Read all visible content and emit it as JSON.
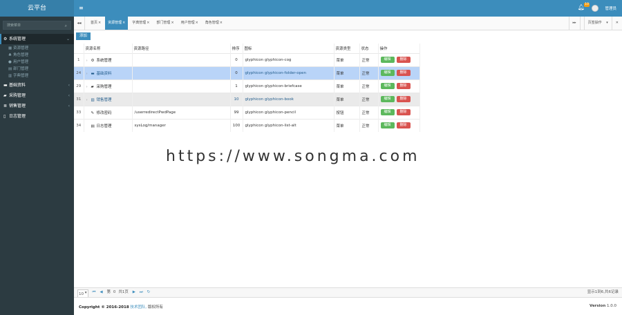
{
  "brand": "云平台",
  "search": {
    "placeholder": "搜索菜单"
  },
  "sidebar": {
    "groups": [
      {
        "label": "系统管理",
        "icon": "gear-icon",
        "arrow": "⌄"
      },
      {
        "label": "基础资料",
        "icon": "folder-icon",
        "arrow": "‹"
      },
      {
        "label": "采购管理",
        "icon": "cart-icon",
        "arrow": "‹"
      },
      {
        "label": "销售管理",
        "icon": "list-icon",
        "arrow": "‹"
      },
      {
        "label": "日志管理",
        "icon": "book-icon",
        "arrow": ""
      }
    ],
    "subitems": [
      {
        "label": "资源管理",
        "icon": "grid-icon"
      },
      {
        "label": "角色管理",
        "icon": "users-icon"
      },
      {
        "label": "用户管理",
        "icon": "user-icon"
      },
      {
        "label": "部门管理",
        "icon": "sitemap-icon"
      },
      {
        "label": "字典管理",
        "icon": "book-icon"
      }
    ]
  },
  "topbar": {
    "notif_count": "10",
    "username": "管理员"
  },
  "tabs": {
    "items": [
      {
        "label": "首页"
      },
      {
        "label": "资源管理"
      },
      {
        "label": "字典管理"
      },
      {
        "label": "部门管理"
      },
      {
        "label": "用户管理"
      },
      {
        "label": "角色管理"
      }
    ],
    "tab_ops": "页签操作"
  },
  "toolbar": {
    "add_label": "添加"
  },
  "table": {
    "headers": [
      "",
      "资源名称",
      "资源路径",
      "排序",
      "图标",
      "资源类型",
      "状态",
      "操作"
    ],
    "rows": [
      {
        "id": "1",
        "name": "系统管理",
        "icon": "gear-icon",
        "path": "",
        "sort": "0",
        "cls": "glyphicon glyphicon-cog",
        "type": "菜单",
        "status": "正常"
      },
      {
        "id": "24",
        "name": "基础资料",
        "icon": "folder-icon",
        "path": "",
        "sort": "0",
        "cls": "glyphicon glyphicon-folder-open",
        "type": "菜单",
        "status": "正常"
      },
      {
        "id": "29",
        "name": "采购管理",
        "icon": "briefcase-icon",
        "path": "",
        "sort": "1",
        "cls": "glyphicon glyphicon-briefcase",
        "type": "菜单",
        "status": "正常"
      },
      {
        "id": "31",
        "name": "销售管理",
        "icon": "book-icon",
        "path": "",
        "sort": "10",
        "cls": "glyphicon glyphicon-book",
        "type": "菜单",
        "status": "正常"
      },
      {
        "id": "33",
        "name": "修改密码",
        "icon": "pencil-icon",
        "path": "/userredirectPwdPage",
        "sort": "99",
        "cls": "glyphicon glyphicon-pencil",
        "type": "按钮",
        "status": "正常"
      },
      {
        "id": "34",
        "name": "日志管理",
        "icon": "list-alt-icon",
        "path": "sysLog/manager",
        "sort": "100",
        "cls": "glyphicon glyphicon-list-alt",
        "type": "菜单",
        "status": "正常"
      }
    ],
    "edit_label": "编辑",
    "delete_label": "删除"
  },
  "pager": {
    "page_size": "10",
    "page_prefix": "第",
    "page_value": "0",
    "page_suffix": "共1页",
    "info": "显示1到6,共6记录"
  },
  "footer": {
    "copyright": "Copyright © 2016-2018",
    "team": "技术团队,",
    "rights": "版权所有",
    "version_label": "Version",
    "version": "1.0.0"
  },
  "watermark": "https://www.songma.com"
}
